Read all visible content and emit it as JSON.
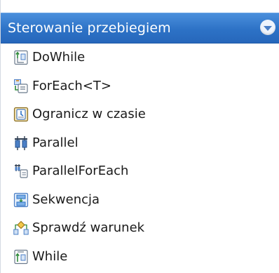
{
  "section": {
    "title": "Sterowanie przebiegiem",
    "collapse_icon": "chevron-down-icon"
  },
  "items": [
    {
      "label": "DoWhile",
      "icon": "dowhile-icon"
    },
    {
      "label": "ForEach<T>",
      "icon": "foreach-icon"
    },
    {
      "label": "Ogranicz w czasie",
      "icon": "timeout-icon"
    },
    {
      "label": "Parallel",
      "icon": "parallel-icon"
    },
    {
      "label": "ParallelForEach",
      "icon": "parallel-foreach-icon"
    },
    {
      "label": "Sekwencja",
      "icon": "sequence-icon"
    },
    {
      "label": "Sprawdź warunek",
      "icon": "condition-icon"
    },
    {
      "label": "While",
      "icon": "while-icon"
    }
  ],
  "colors": {
    "header_bg": "#2d72c6",
    "header_text": "#ffffff",
    "item_text": "#1a1a1a"
  }
}
